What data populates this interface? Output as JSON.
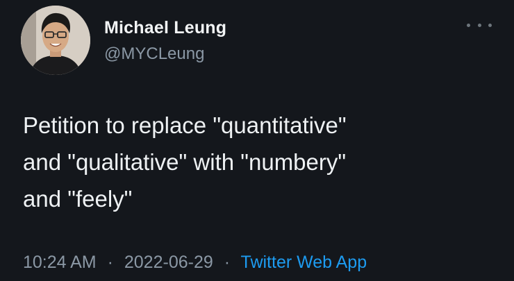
{
  "author": {
    "display_name": "Michael Leung",
    "handle": "@MYCLeung",
    "avatar_icon": "profile-photo"
  },
  "tweet": {
    "text": "Petition to replace \"quantitative\"\nand \"qualitative\" with \"numbery\"\nand \"feely\""
  },
  "meta": {
    "time": "10:24 AM",
    "separator": "·",
    "date": "2022-06-29",
    "source": "Twitter Web App"
  },
  "colors": {
    "background": "#14171c",
    "text": "#e7e9ea",
    "secondary": "#8b98a5",
    "link": "#1d9bf0"
  },
  "icons": {
    "more": "more-horizontal-icon"
  }
}
